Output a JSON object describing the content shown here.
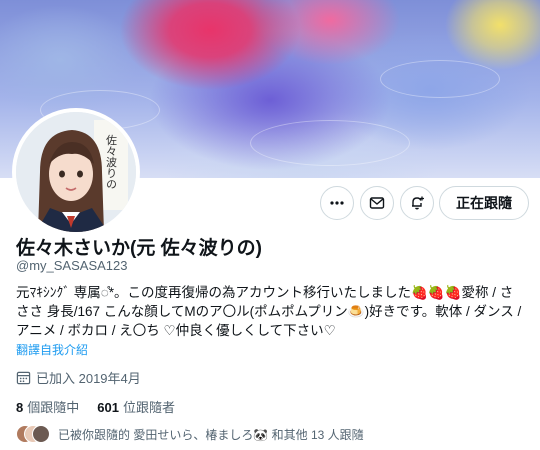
{
  "profile": {
    "display_name": "佐々木さいか(元 佐々波りの)",
    "handle": "@my_SASASA123",
    "bio_line1": "元ﾏｷｼﾝｸﾞ 専属◌̊*。この度再復帰の為アカウント移行いたしました",
    "bio_hearts": "🍓🍓🍓",
    "bio_line1_tail": "愛称 / さ",
    "bio_line2": "ささ 身長/167 こんな顔してMのア〇ル(ポムポムプリン🍮)好きです。軟体 / ダンス / アニメ / ボカロ / え〇ち ♡仲良く優しくして下さい♡",
    "translate_link": "翻譯自我介紹",
    "joined": "已加入 2019年4月"
  },
  "stats": {
    "following_count": "8",
    "following_label": "個跟隨中",
    "followers_count": "601",
    "followers_label": "位跟隨者"
  },
  "followed_by": "已被你跟隨的 愛田せいら、椿ましろ🐼 和其他 13 人跟隨",
  "actions": {
    "follow_label": "正在跟隨",
    "more_icon": "more-horizontal-icon",
    "message_icon": "envelope-icon",
    "notify_icon": "bell-plus-icon"
  },
  "colors": {
    "accent": "#1d9bf0",
    "text": "#0f1419",
    "muted": "#536471",
    "border": "#cfd9de"
  }
}
